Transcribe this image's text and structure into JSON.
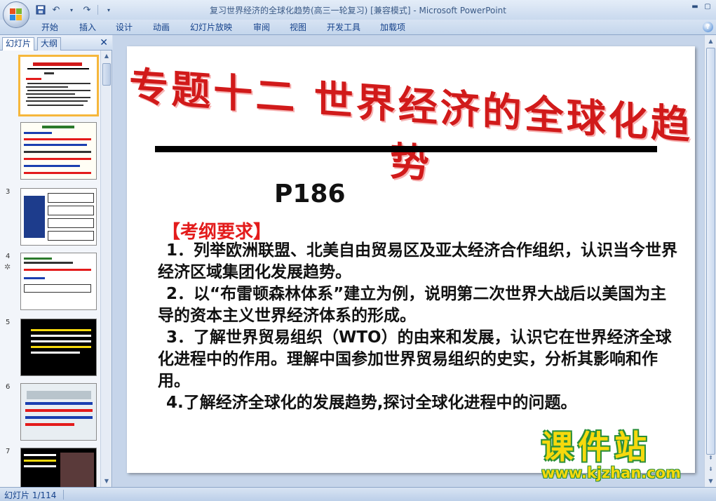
{
  "window": {
    "title": "复习世界经济的全球化趋势(高三一轮复习) [兼容模式] - Microsoft PowerPoint"
  },
  "quick_access": {
    "save_icon": "save-icon",
    "undo_icon": "undo-icon",
    "redo_icon": "redo-icon"
  },
  "ribbon": {
    "tabs": [
      "开始",
      "插入",
      "设计",
      "动画",
      "幻灯片放映",
      "审阅",
      "视图",
      "开发工具",
      "加载项"
    ]
  },
  "left_panel": {
    "tabs": [
      "幻灯片",
      "大纲"
    ],
    "close_label": "✕",
    "slide_numbers": [
      "",
      "",
      "3",
      "4",
      "5",
      "6",
      "7"
    ]
  },
  "slide": {
    "title": "专题十二 世界经济的全球化趋势",
    "page_ref": "P186",
    "section_heading": "【考纲要求】",
    "paragraphs": [
      "1．列举欧洲联盟、北美自由贸易区及亚太经济合作组织，认识当今世界经济区域集团化发展趋势。",
      "2．以“布雷顿森林体系”建立为例，说明第二次世界大战后以美国为主导的资本主义世界经济体系的形成。",
      "3．了解世界贸易组织（WTO）的由来和发展，认识它在世界经济全球化进程中的作用。理解中国参加世界贸易组织的史实，分析其影响和作用。",
      "4.了解经济全球化的发展趋势,探讨全球化进程中的问题。"
    ]
  },
  "watermark": {
    "line1": "课件站",
    "line2": "www.kjzhan.com"
  },
  "status_bar": {
    "slide_info": "幻灯片 1/114"
  },
  "colors": {
    "title_red": "#d11a1a",
    "heading_red": "#e31b1b",
    "selection_orange": "#f6b73c"
  }
}
